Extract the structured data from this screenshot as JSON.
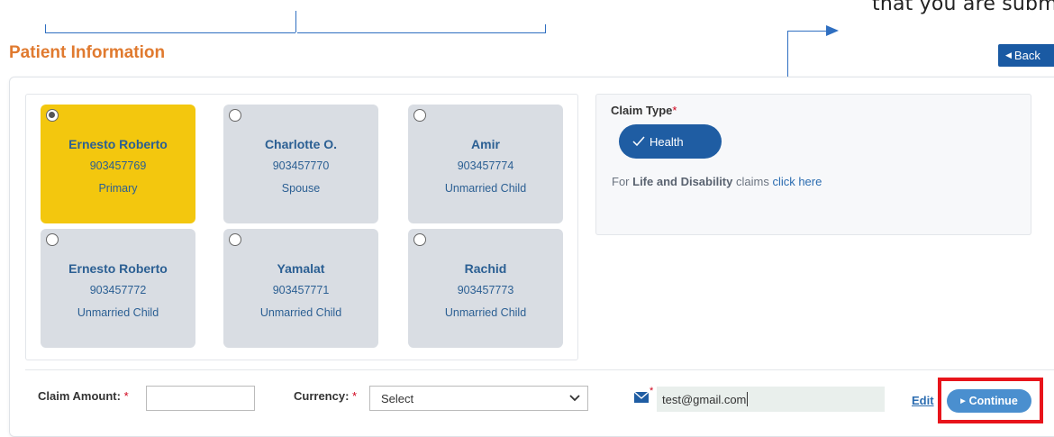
{
  "annotation": {
    "caption": "that you are subm"
  },
  "header": {
    "title": "Patient Information",
    "back_label": "Back"
  },
  "members": [
    {
      "name": "Ernesto Roberto",
      "member_id": "903457769",
      "relation": "Primary",
      "selected": true
    },
    {
      "name": "Charlotte O.",
      "member_id": "903457770",
      "relation": "Spouse",
      "selected": false
    },
    {
      "name": "Amir",
      "member_id": "903457774",
      "relation": "Unmarried Child",
      "selected": false
    },
    {
      "name": "Ernesto Roberto",
      "member_id": "903457772",
      "relation": "Unmarried Child",
      "selected": false
    },
    {
      "name": "Yamalat",
      "member_id": "903457771",
      "relation": "Unmarried Child",
      "selected": false
    },
    {
      "name": "Rachid",
      "member_id": "903457773",
      "relation": "Unmarried Child",
      "selected": false
    }
  ],
  "claim_type": {
    "label": "Claim Type",
    "required_mark": "*",
    "selected_option": "Health",
    "alt_prefix": "For ",
    "alt_bold": "Life and Disability",
    "alt_middle": " claims ",
    "alt_link": "click here"
  },
  "form": {
    "amount_label": "Claim Amount:",
    "amount_value": "",
    "required_mark": "*",
    "currency_label": "Currency:",
    "currency_selected": "Select",
    "email_value": "test@gmail.com",
    "edit_label": "Edit",
    "continue_label": "Continue"
  },
  "colors": {
    "accent_title": "#e07a2f",
    "primary_blue": "#1f5da3",
    "selected_card": "#f3c70e",
    "card_gray": "#d9dde3",
    "highlight": "#e8141b"
  }
}
